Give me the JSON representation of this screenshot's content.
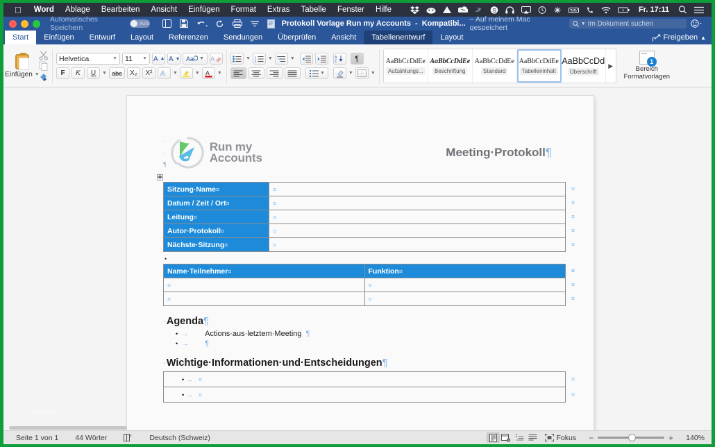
{
  "macmenu": {
    "apple": "apple-logo",
    "items": [
      "Word",
      "Ablage",
      "Bearbeiten",
      "Ansicht",
      "Einfügen",
      "Format",
      "Extras",
      "Tabelle",
      "Fenster",
      "Hilfe"
    ],
    "status_icons": [
      "dropbox-icon",
      "cloud-icon",
      "drive-icon",
      "onedrive-icon",
      "bluetooth-off-icon",
      "skype-icon",
      "headphones-icon",
      "airplay-icon",
      "clock-icon",
      "network-icon",
      "keyboard-icon",
      "phone-icon",
      "wifi-icon",
      "battery-icon"
    ],
    "clock": "Fr. 17:11",
    "search_icon": "spotlight-search-icon",
    "control_center_icon": "control-center-icon"
  },
  "titlebar": {
    "autosave_label": "Automatisches Speichern",
    "autosave_state": "AUS",
    "icons": [
      "sidebar-toggle-icon",
      "save-icon",
      "undo-icon",
      "redo-icon",
      "print-icon",
      "customize-toolbar-icon"
    ],
    "doc_icon": "word-document-icon",
    "doc_title": "Protokoll Vorlage Run my Accounts",
    "separator": "-",
    "compat": "Kompatibi...",
    "saved_location": "– Auf meinem Mac gespeichert",
    "search_placeholder": "Im Dokument suchen",
    "search_icon": "search-icon",
    "account_icon": "smiley-account-icon"
  },
  "tabs": {
    "items": [
      {
        "label": "Start",
        "state": "active"
      },
      {
        "label": "Einfügen",
        "state": "normal"
      },
      {
        "label": "Entwurf",
        "state": "normal"
      },
      {
        "label": "Layout",
        "state": "normal"
      },
      {
        "label": "Referenzen",
        "state": "normal"
      },
      {
        "label": "Sendungen",
        "state": "normal"
      },
      {
        "label": "Überprüfen",
        "state": "normal"
      },
      {
        "label": "Ansicht",
        "state": "normal"
      },
      {
        "label": "Tabellenentwurf",
        "state": "context"
      },
      {
        "label": "Layout",
        "state": "normal"
      }
    ],
    "share_label": "Freigeben",
    "share_icon": "share-icon",
    "collapse_icon": "chevron-up-icon"
  },
  "ribbon": {
    "paste_label": "Einfügen",
    "paste_icon": "clipboard-icon",
    "cut_icon": "scissors-icon",
    "copy_icon": "copy-icon",
    "format_painter_icon": "format-painter-icon",
    "font_name": "Helvetica",
    "font_size": "11",
    "grow_font_icon": "grow-font-icon",
    "shrink_font_icon": "shrink-font-icon",
    "change_case_icon": "change-case-icon",
    "clear_format_icon": "clear-formatting-icon",
    "bold_label": "F",
    "italic_label": "K",
    "underline_label": "U",
    "strikethrough_label": "abc",
    "subscript_label": "X₂",
    "superscript_label": "X²",
    "text_effects_icon": "text-effects-icon",
    "highlight_icon": "highlight-color-icon",
    "font_color_icon": "font-color-icon",
    "bullets_icon": "bullet-list-icon",
    "numbering_icon": "numbered-list-icon",
    "multilevel_icon": "multilevel-list-icon",
    "decrease_indent_icon": "decrease-indent-icon",
    "increase_indent_icon": "increase-indent-icon",
    "sort_icon": "sort-az-icon",
    "show_marks_icon": "show-paragraph-marks-icon",
    "align_left_icon": "align-left-icon",
    "align_center_icon": "align-center-icon",
    "align_right_icon": "align-right-icon",
    "align_justify_icon": "align-justify-icon",
    "line_spacing_icon": "line-spacing-icon",
    "shading_icon": "shading-icon",
    "borders_icon": "borders-icon",
    "styles": [
      {
        "sample": "AaBbCcDdEe",
        "name": "Aufzählungs...",
        "variant": "serif",
        "selected": false
      },
      {
        "sample": "AaBbCcDdEe",
        "name": "Beschriftung",
        "variant": "serif-italic",
        "selected": false
      },
      {
        "sample": "AaBbCcDdEe",
        "name": "Standard",
        "variant": "serif",
        "selected": false
      },
      {
        "sample": "AaBbCcDdEe",
        "name": "Tabelleninhalt",
        "variant": "serif",
        "selected": true
      },
      {
        "sample": "AaBbCcDd",
        "name": "Überschrift",
        "variant": "sans",
        "selected": false
      }
    ],
    "styles_more_icon": "chevron-right-icon",
    "styles_pane_label": "Bereich\nFormatvorlagen",
    "styles_pane_line1": "Bereich",
    "styles_pane_line2": "Formatvorlagen",
    "styles_pane_badge": "1"
  },
  "document": {
    "watermark": "vorlagen",
    "logo_line1": "Run my",
    "logo_line2": "Accounts",
    "title": "Meeting·Protokoll",
    "pilcrow": "¶",
    "table_meeting": {
      "rows": [
        {
          "label": "Sitzung·Name",
          "value": ""
        },
        {
          "label": "Datum / Zeit / Ort",
          "value": ""
        },
        {
          "label": "Leitung",
          "value": ""
        },
        {
          "label": "Autor·Protokoll",
          "value": ""
        },
        {
          "label": "Nächste·Sitzung",
          "value": ""
        }
      ]
    },
    "table_participants": {
      "headers": [
        "Name·Teilnehmer",
        "Funktion"
      ],
      "rows": [
        [
          "",
          ""
        ],
        [
          "",
          ""
        ]
      ]
    },
    "agenda_heading": "Agenda",
    "agenda_items": [
      "Actions·aus·letztem·Meeting",
      ""
    ],
    "info_heading": "Wichtige·Informationen·und·Entscheidungen",
    "info_rows": [
      "",
      ""
    ],
    "cell_mark": "¤",
    "bullet_char": "•",
    "tab_arrow": "→"
  },
  "statusbar": {
    "page": "Seite 1 von 1",
    "words": "44 Wörter",
    "proofing_icon": "proofing-errors-icon",
    "language": "Deutsch (Schweiz)",
    "views": [
      "print-layout-icon",
      "web-layout-icon",
      "outline-icon",
      "draft-icon"
    ],
    "focus_label": "Fokus",
    "focus_icon": "focus-icon",
    "zoom_out": "−",
    "zoom_in": "+",
    "zoom_level": "140%"
  },
  "colors": {
    "word_blue": "#2b579a",
    "table_header_blue": "#1d8bd9",
    "mac_menu": "#2b313d",
    "desktop_green": "#0f9d3a",
    "mark_blue": "#8ec4ee"
  }
}
